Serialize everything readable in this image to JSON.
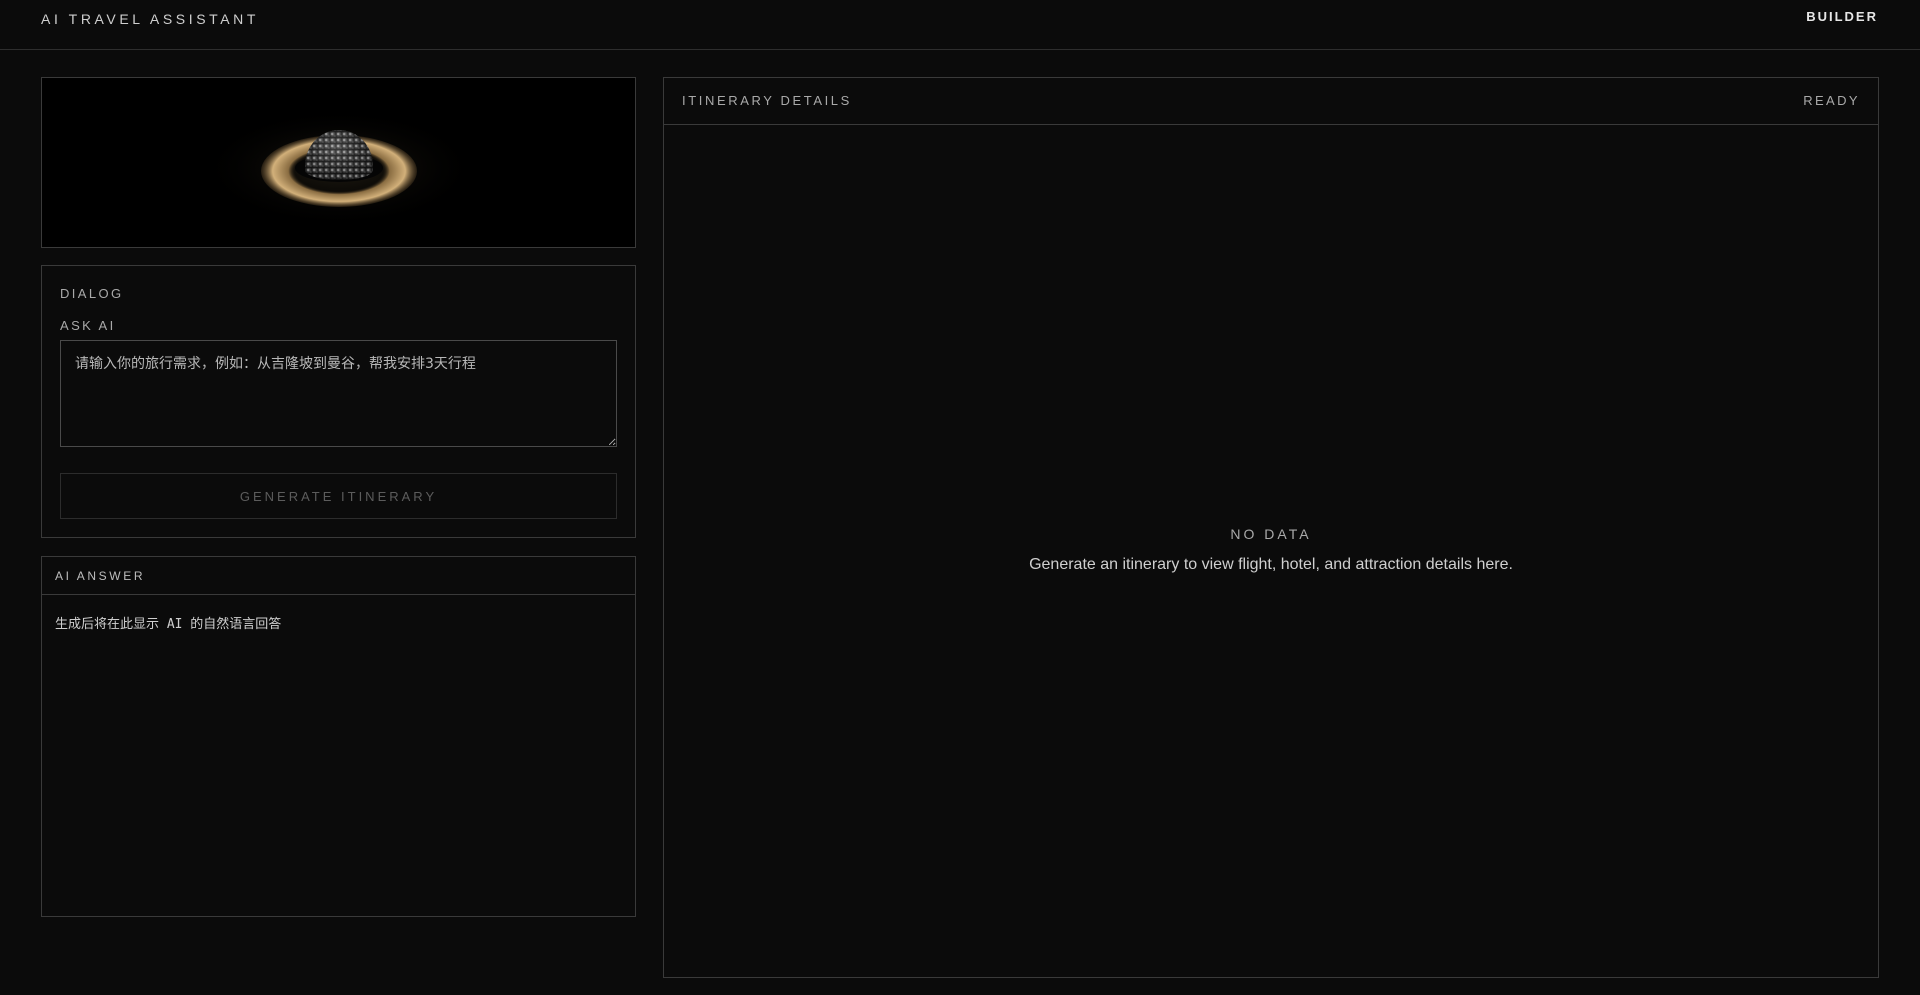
{
  "header": {
    "app_title": "AI TRAVEL ASSISTANT",
    "builder_label": "BUILDER"
  },
  "dialog": {
    "title": "DIALOG",
    "ask_label": "ASK AI",
    "prompt_placeholder": "请输入你的旅行需求，例如：从吉隆坡到曼谷，帮我安排3天行程",
    "generate_label": "GENERATE ITINERARY"
  },
  "answer": {
    "title": "AI ANSWER",
    "placeholder_text": "生成后将在此显示 AI 的自然语言回答"
  },
  "itinerary": {
    "title": "ITINERARY DETAILS",
    "status": "READY",
    "empty_title": "NO DATA",
    "empty_desc": "Generate an itinerary to view flight, hotel, and attraction details here."
  },
  "colors": {
    "background": "#0b0b0b",
    "border": "#3a3a3a",
    "ring_gold": "#c9a46a"
  }
}
